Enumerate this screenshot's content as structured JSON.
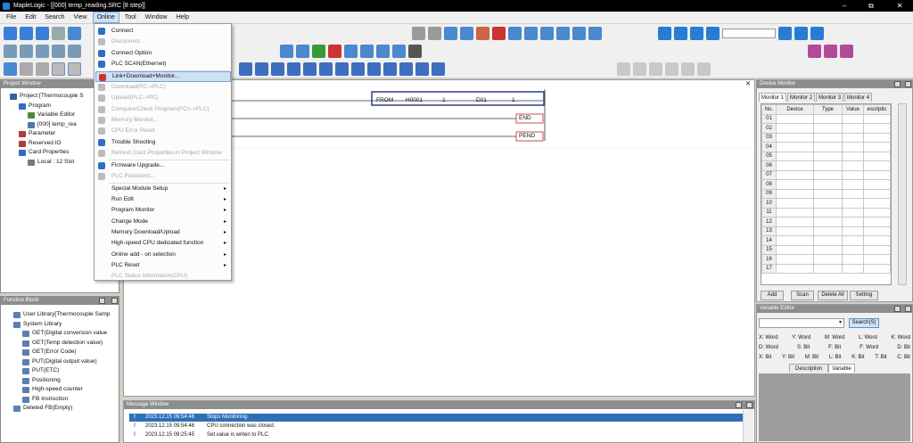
{
  "window": {
    "title": "MapleLogic - [[000] temp_reading.SRC [8 step]]",
    "min": "–",
    "max": "⧉",
    "close": "✕"
  },
  "menu": [
    "File",
    "Edit",
    "Search",
    "View",
    "Online",
    "Tool",
    "Window",
    "Help"
  ],
  "online_menu": {
    "items": [
      {
        "label": "Connect",
        "disabled": false,
        "arrow": false
      },
      {
        "label": "Disconnect",
        "disabled": true,
        "arrow": false
      },
      {
        "label": "Connect Option",
        "disabled": false,
        "arrow": false
      },
      {
        "label": "PLC SCAN(Ethernet)",
        "disabled": false,
        "arrow": false
      },
      {
        "label": "Link+Download+Monitor...",
        "disabled": false,
        "arrow": false,
        "highlighted": true
      },
      {
        "label": "Download(PC->PLC)",
        "disabled": true,
        "arrow": false
      },
      {
        "label": "Upload(PLC->PC)",
        "disabled": true,
        "arrow": false
      },
      {
        "label": "Compare/Check Program(PC<->PLC)",
        "disabled": true,
        "arrow": false
      },
      {
        "label": "Memory Monitor...",
        "disabled": true,
        "arrow": false
      },
      {
        "label": "CPU Error Reset",
        "disabled": true,
        "arrow": false
      },
      {
        "label": "Trouble Shooting",
        "disabled": false,
        "arrow": false
      },
      {
        "label": "Refresh Card Properties in Project Window",
        "disabled": true,
        "arrow": false
      },
      {
        "label": "Firmware Upgrade...",
        "disabled": false,
        "arrow": false
      },
      {
        "label": "PLC Password...",
        "disabled": true,
        "arrow": false
      },
      {
        "label": "Special Module Setup",
        "disabled": false,
        "arrow": true
      },
      {
        "label": "Run Edit",
        "disabled": false,
        "arrow": true
      },
      {
        "label": "Program Monitor",
        "disabled": false,
        "arrow": true
      },
      {
        "label": "Change Mode",
        "disabled": false,
        "arrow": true
      },
      {
        "label": "Memory Download/Upload",
        "disabled": false,
        "arrow": true
      },
      {
        "label": "High-speed CPU dedicated function",
        "disabled": false,
        "arrow": true
      },
      {
        "label": "Online add - on selection",
        "disabled": false,
        "arrow": true
      },
      {
        "label": "PLC Reset",
        "disabled": false,
        "arrow": true
      },
      {
        "label": "PLC Status Information(CPU)",
        "disabled": true,
        "arrow": false
      }
    ]
  },
  "project_window": {
    "title": "Project Window",
    "tree": [
      {
        "label": "Project [Thermocouple S",
        "indent": 0,
        "color": "#3a5fa0"
      },
      {
        "label": "Program",
        "indent": 1,
        "color": "#2c6cc8"
      },
      {
        "label": "Variable Editor",
        "indent": 2,
        "color": "#4b8a3c"
      },
      {
        "label": "[000] temp_rea",
        "indent": 2,
        "color": "#5277a8"
      },
      {
        "label": "Parameter",
        "indent": 1,
        "color": "#b23a3a"
      },
      {
        "label": "Reserved IO",
        "indent": 1,
        "color": "#b23a3a"
      },
      {
        "label": "Card Properties",
        "indent": 1,
        "color": "#2c6cc8"
      },
      {
        "label": "Local : 12 Slot",
        "indent": 2,
        "color": "#7a7a7a"
      }
    ]
  },
  "function_block": {
    "title": "Function Block",
    "tree": [
      {
        "label": "User Library[Thermocouple Samp",
        "indent": 0
      },
      {
        "label": "System Library",
        "indent": 0
      },
      {
        "label": "GET(Digital conversion value",
        "indent": 1
      },
      {
        "label": "GET(Temp detection value)",
        "indent": 1
      },
      {
        "label": "GET(Error Code)",
        "indent": 1
      },
      {
        "label": "PUT(Digital output value)",
        "indent": 1
      },
      {
        "label": "PUT(ETC)",
        "indent": 1
      },
      {
        "label": "Positioning",
        "indent": 1
      },
      {
        "label": "High-speed counter",
        "indent": 1
      },
      {
        "label": "FB Instruction",
        "indent": 1
      },
      {
        "label": "Deleted FB(Empty)",
        "indent": 0
      }
    ]
  },
  "ladder": {
    "from": [
      "FROM",
      "H0001",
      "1",
      "D01",
      "1"
    ],
    "end": "END",
    "pend": "PEND"
  },
  "message_window": {
    "title": "Message Window",
    "rows": [
      {
        "time": "2023.12.15 09:54:46",
        "text": "Stops Monitoring."
      },
      {
        "time": "2023.12.15 09:54:46",
        "text": "CPU connection was closed."
      },
      {
        "time": "2023.12.15 09:25:45",
        "text": "Set value is writen to PLC."
      }
    ]
  },
  "device_monitor": {
    "title": "Device Monitor",
    "tabs": [
      "Monitor 1",
      "Monitor 2",
      "Monitor 3",
      "Monitor 4"
    ],
    "columns": [
      "No.",
      "Device",
      "Type",
      "Value",
      "escriptic"
    ],
    "rows": [
      "01",
      "02",
      "03",
      "04",
      "05",
      "06",
      "07",
      "08",
      "09",
      "10",
      "11",
      "12",
      "13",
      "14",
      "15",
      "16",
      "17"
    ],
    "buttons": [
      "Add",
      "Scan",
      "Delete All",
      "Setting"
    ]
  },
  "variable_editor": {
    "title": "Variable Editor",
    "search_label": "Search(S)",
    "row1": [
      "X: Word",
      "Y: Word",
      "M: Word",
      "L: Word",
      "K: Word"
    ],
    "row2": [
      "D: Word",
      "S: Bit",
      "F: Bit",
      "F: Word",
      "D: Bit"
    ],
    "row3": [
      "X: Bit",
      "Y: Bit",
      "M: Bit",
      "L: Bit",
      "K: Bit",
      "T: Bit",
      "C: Bit"
    ],
    "tabs": [
      "Description",
      "Variable"
    ]
  }
}
